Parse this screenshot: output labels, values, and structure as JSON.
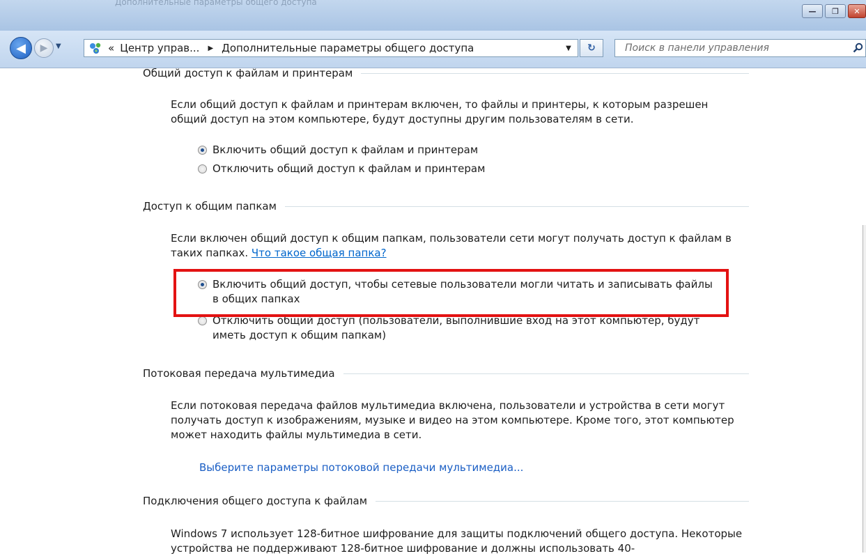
{
  "window": {
    "faint_title": "Дополнительные параметры общего доступа",
    "buttons": {
      "minimize": "—",
      "maximize": "❐",
      "close": "✕"
    }
  },
  "nav": {
    "back_glyph": "◀",
    "forward_glyph": "▶",
    "history_glyph": "▼",
    "address": {
      "chevron": "«",
      "crumbs": [
        "Центр управ...",
        "Дополнительные параметры общего доступа"
      ],
      "separator": "▶",
      "dropdown_glyph": "▼"
    },
    "refresh_glyph": "↻",
    "search_placeholder": "Поиск в панели управления"
  },
  "sections": [
    {
      "title": "Общий доступ к файлам и принтерам",
      "description": "Если общий доступ к файлам и принтерам включен, то файлы и принтеры, к которым разрешен общий доступ на этом компьютере, будут доступны другим пользователям в сети.",
      "options": [
        {
          "label": "Включить общий доступ к файлам и принтерам",
          "checked": true
        },
        {
          "label": "Отключить общий доступ к файлам и принтерам",
          "checked": false
        }
      ]
    },
    {
      "title": "Доступ к общим папкам",
      "description": "Если включен общий доступ к общим папкам, пользователи сети могут получать доступ к файлам в таких папках.",
      "link": "Что такое общая папка?",
      "options": [
        {
          "label": "Включить общий доступ, чтобы сетевые пользователи могли читать и записывать файлы в общих папках",
          "checked": true
        },
        {
          "label": "Отключить общий доступ (пользователи, выполнившие вход на этот компьютер, будут иметь доступ к общим папкам)",
          "checked": false
        }
      ]
    },
    {
      "title": "Потоковая передача мультимедиа",
      "description": "Если потоковая передача файлов мультимедиа включена, пользователи и устройства в сети могут получать доступ к изображениям, музыке и видео на этом компьютере. Кроме того, этот компьютер может находить файлы мультимедиа в сети.",
      "link": "Выберите параметры потоковой передачи мультимедиа..."
    },
    {
      "title": "Подключения общего доступа к файлам",
      "description": "Windows 7 использует 128-битное шифрование для защиты подключений общего доступа. Некоторые устройства не поддерживают 128-битное шифрование и должны использовать 40-"
    }
  ],
  "colors": {
    "highlight": "#e31212",
    "link": "#0066cc",
    "accent": "#1d5fc2"
  }
}
